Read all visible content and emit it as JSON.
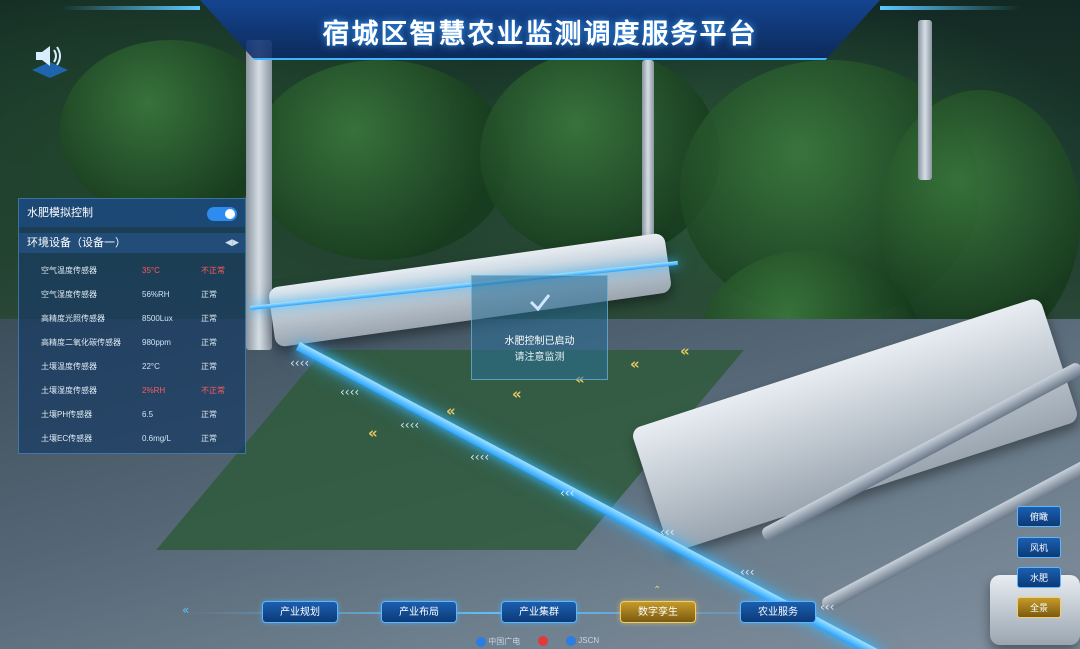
{
  "header": {
    "title": "宿城区智慧农业监测调度服务平台"
  },
  "panel": {
    "title": "水肥模拟控制",
    "toggle_on": true,
    "subtitle": "环境设备（设备一）",
    "rows": [
      {
        "name": "空气温度传感器",
        "value": "35°C",
        "status": "不正常",
        "ok": false
      },
      {
        "name": "空气湿度传感器",
        "value": "56%RH",
        "status": "正常",
        "ok": true
      },
      {
        "name": "高精度光照传感器",
        "value": "8500Lux",
        "status": "正常",
        "ok": true
      },
      {
        "name": "高精度二氧化碳传感器",
        "value": "980ppm",
        "status": "正常",
        "ok": true
      },
      {
        "name": "土壤温度传感器",
        "value": "22°C",
        "status": "正常",
        "ok": true
      },
      {
        "name": "土壤湿度传感器",
        "value": "2%RH",
        "status": "不正常",
        "ok": false
      },
      {
        "name": "土壤PH传感器",
        "value": "6.5",
        "status": "正常",
        "ok": true
      },
      {
        "name": "土壤EC传感器",
        "value": "0.6mg/L",
        "status": "正常",
        "ok": true
      }
    ]
  },
  "popup": {
    "line1": "水肥控制已启动",
    "line2": "请注意监测"
  },
  "bottom_nav": [
    {
      "label": "产业规划",
      "active": false
    },
    {
      "label": "产业布局",
      "active": false
    },
    {
      "label": "产业集群",
      "active": false
    },
    {
      "label": "数字孪生",
      "active": true
    },
    {
      "label": "农业服务",
      "active": false
    }
  ],
  "right_buttons": [
    {
      "label": "俯瞰",
      "active": false
    },
    {
      "label": "风机",
      "active": false
    },
    {
      "label": "水肥",
      "active": false
    },
    {
      "label": "全景",
      "active": true
    }
  ],
  "footer_logos": [
    "中国广电",
    "JSCN"
  ],
  "colors": {
    "accent": "#2e8cf0",
    "active_gold": "#c69a2a",
    "alert_red": "#ff5a5a",
    "pipe_glow": "#38b6ff"
  }
}
